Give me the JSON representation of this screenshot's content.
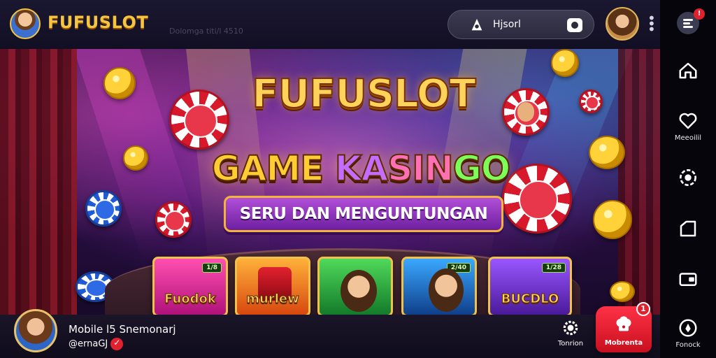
{
  "header": {
    "brand": "FUFUSLOT",
    "subtitle": "Dolomga titi/l 4510",
    "search_text": "Hjsorl",
    "more_label": "⋮"
  },
  "sidebar": {
    "items": [
      {
        "icon": "menu-icon",
        "label": "",
        "badge": "!"
      },
      {
        "icon": "home-icon",
        "label": ""
      },
      {
        "icon": "heart-icon",
        "label": "Meeoilil"
      },
      {
        "icon": "gear-face-icon",
        "label": ""
      },
      {
        "icon": "folder-icon",
        "label": ""
      },
      {
        "icon": "wallet-icon",
        "label": ""
      },
      {
        "icon": "location-icon",
        "label": "Fonock"
      }
    ]
  },
  "hero": {
    "title": "FUFUSLOT",
    "subtitle_parts": [
      "GAME ",
      "KA",
      "SIN",
      "GO"
    ],
    "ribbon": "SERU DAN MENGUNTUNGAN",
    "games": [
      {
        "title": "Fuodok",
        "badge": "1/8",
        "theme": "pink"
      },
      {
        "title": "murlew",
        "badge": "",
        "theme": "orange"
      },
      {
        "title": "",
        "badge": "",
        "theme": "green"
      },
      {
        "title": "",
        "badge": "2/40",
        "theme": "blue"
      },
      {
        "title": "BUCDLO",
        "badge": "1/28",
        "theme": "purple"
      }
    ]
  },
  "footer": {
    "name": "Mobile l5 Snemonarj",
    "handle": "@ernaGJ",
    "center_label": "Tonrion",
    "hot_label": "Mobrenta",
    "hot_badge": "1"
  },
  "colors": {
    "brand_gold": "#f5c542",
    "accent_red": "#e3212e",
    "ribbon_purple": "#8a2fc4"
  }
}
